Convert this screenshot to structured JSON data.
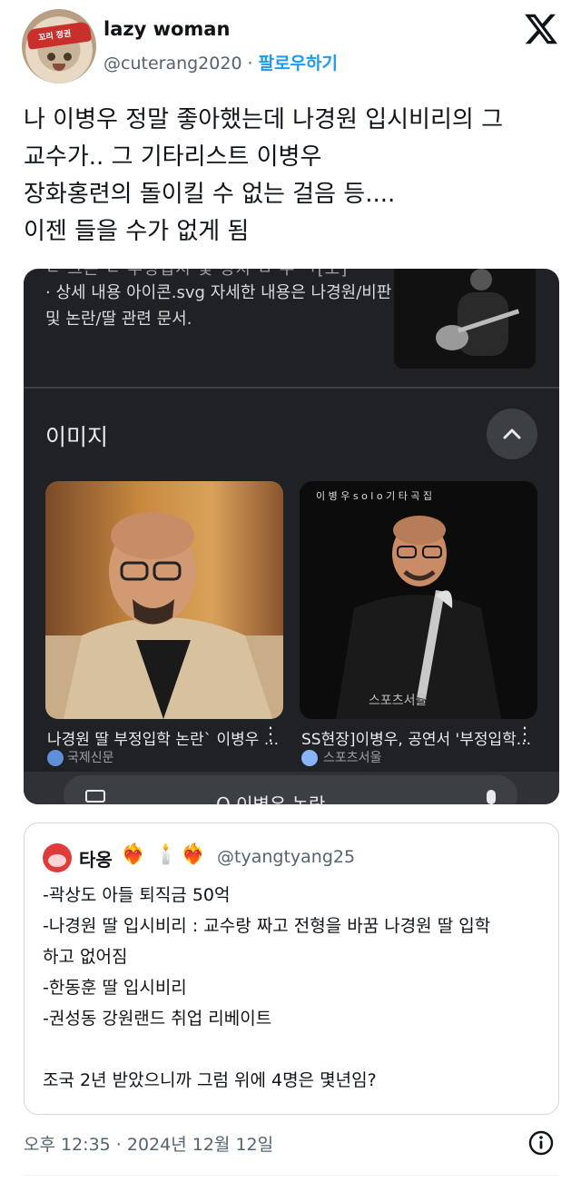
{
  "author": {
    "display_name": "lazy woman",
    "handle": "@cuterang2020",
    "separator": "·",
    "follow_label": "팔로우하기",
    "avatar_band_text": "꼬리 정권"
  },
  "tweet": {
    "lines": [
      "나 이병우 정말 좋아했는데 나경원 입시비리의 그",
      "교수가.. 그 기타리스트 이병우",
      "장화홍련의 돌이킬 수 없는 걸음 등....",
      "이젠 들을 수가 없게 됨"
    ]
  },
  "media": {
    "clipped_line": "ㄴ 그는 ㄴ 부정입시 및 정치 ㅁ 주 ㄱ[도]",
    "top_text": "· 상세 내용 아이콘.svg 자세한 내용은 나경원/비판 및 논란/딸 관련 문서.",
    "section_title": "이미지",
    "image_results": [
      {
        "caption": "나경원 딸 부정입학 논란` 이병우 ...",
        "source": "국제신문",
        "more": "⋮"
      },
      {
        "caption": "SS현장]이병우, 공연서 '부정입학...",
        "source": "스포츠서울",
        "more": "⋮"
      }
    ],
    "search_query": "Q 이병우 논란",
    "watermark": "스포츠서울",
    "album_text": "이 병 우 s o l o  기 타 곡 집"
  },
  "quote": {
    "name": "타옹",
    "handle": "@tyangtyang25",
    "emojis": [
      "❤️‍🔥",
      "🕯️",
      "❤️‍🔥"
    ],
    "lines": [
      "-곽상도 아들 퇴직금 50억",
      "-나경원 딸 입시비리 : 교수랑 짜고 전형을 바꿈 나경원 딸 입학",
      "하고 없어짐",
      "-한동훈 딸 입시비리",
      "-권성동 강원랜드 취업 리베이트",
      "",
      "조국 2년 받았으니까 그럼 위에 4명은 몇년임?"
    ]
  },
  "footer": {
    "timestamp": "오후 12:35 · 2024년 12월 12일"
  },
  "icons": {
    "x_logo": "x-logo-icon",
    "info": "info-icon",
    "collapse": "chevron-up-icon"
  }
}
